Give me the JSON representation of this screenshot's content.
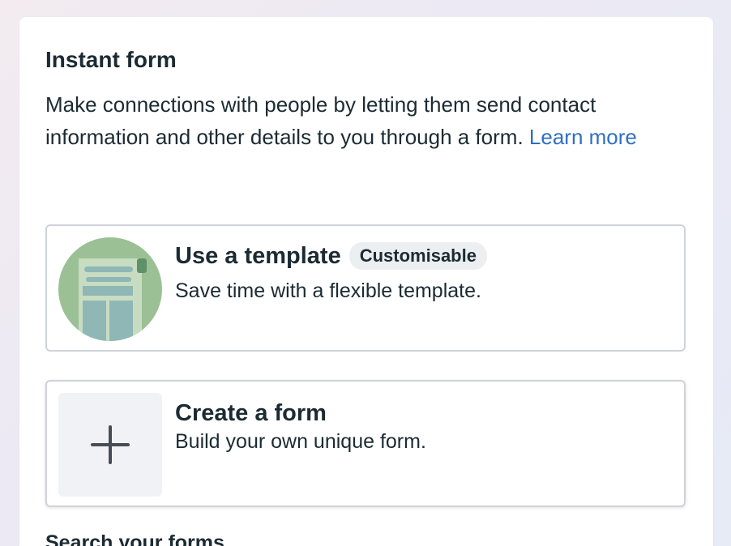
{
  "panel": {
    "title": "Instant form",
    "description": "Make connections with people by letting them send contact information and other details to you through a form.",
    "learn_more_label": "Learn more"
  },
  "options": {
    "template": {
      "title": "Use a template",
      "badge": "Customisable",
      "description": "Save time with a flexible template.",
      "icon": "form-template-icon"
    },
    "create": {
      "title": "Create a form",
      "description": "Build your own unique form.",
      "icon": "plus-icon"
    }
  },
  "search_section": {
    "heading": "Search your forms"
  },
  "colors": {
    "link": "#2f6fc4",
    "template_circle": "#9cc095",
    "template_paper": "#c8dcc1",
    "template_columns": "#8fb7b5"
  }
}
